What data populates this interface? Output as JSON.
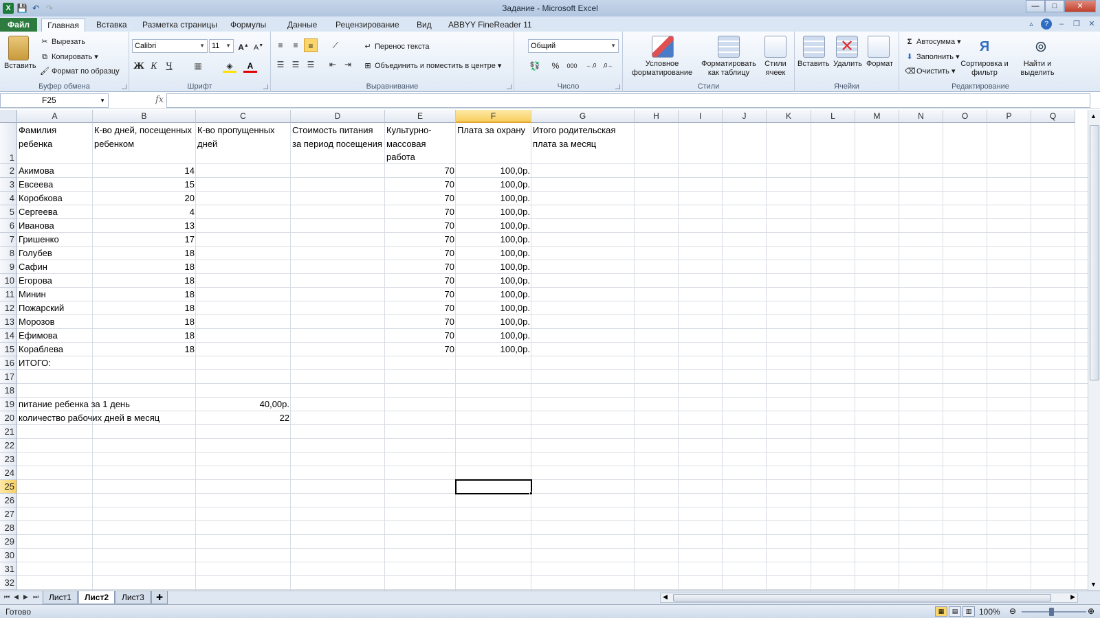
{
  "window": {
    "title": "Задание - Microsoft Excel",
    "controls": [
      "—",
      "□",
      "✕"
    ]
  },
  "qat": {
    "logo": "X",
    "save": "💾",
    "undo": "↶",
    "redo": "↷"
  },
  "tabs": {
    "file": "Файл",
    "items": [
      "Главная",
      "Вставка",
      "Разметка страницы",
      "Формулы",
      "Данные",
      "Рецензирование",
      "Вид",
      "ABBYY FineReader 11"
    ]
  },
  "ribbon": {
    "clipboard": {
      "label": "Буфер обмена",
      "paste": "Вставить",
      "cut": "Вырезать",
      "copy": "Копировать",
      "format_painter": "Формат по образцу"
    },
    "font": {
      "label": "Шрифт",
      "name": "Calibri",
      "size": "11",
      "bold": "Ж",
      "italic": "К",
      "underline": "Ч"
    },
    "alignment": {
      "label": "Выравнивание",
      "wrap": "Перенос текста",
      "merge": "Объединить и поместить в центре"
    },
    "number": {
      "label": "Число",
      "format": "Общий",
      "percent": "%",
      "thousands": "000"
    },
    "styles": {
      "label": "Стили",
      "conditional": "Условное форматирование",
      "as_table": "Форматировать как таблицу",
      "cell_styles": "Стили ячеек"
    },
    "cells": {
      "label": "Ячейки",
      "insert": "Вставить",
      "delete": "Удалить",
      "format": "Формат"
    },
    "editing": {
      "label": "Редактирование",
      "autosum": "Автосумма",
      "fill": "Заполнить",
      "clear": "Очистить",
      "sort": "Сортировка и фильтр",
      "find": "Найти и выделить"
    }
  },
  "formula_bar": {
    "name_box": "F25",
    "fx": "fx",
    "value": ""
  },
  "columns": [
    "A",
    "B",
    "C",
    "D",
    "E",
    "F",
    "G",
    "H",
    "I",
    "J",
    "K",
    "L",
    "M",
    "N",
    "O",
    "P",
    "Q"
  ],
  "rows": [
    "1",
    "2",
    "3",
    "4",
    "5",
    "6",
    "7",
    "8",
    "9",
    "10",
    "11",
    "12",
    "13",
    "14",
    "15",
    "16",
    "17",
    "18",
    "19",
    "20",
    "21",
    "22",
    "23",
    "24",
    "25",
    "26",
    "27",
    "28",
    "29",
    "30",
    "31",
    "32"
  ],
  "headers": {
    "a": "Фамилия ребенка",
    "b": "К-во дней, посещенных ребенком",
    "c": "К-во пропущенных дней",
    "d": "Стоимость питания за период посещения",
    "e": "Культурно-массовая работа",
    "f": "Плата за охрану",
    "g": "Итого родительская плата за месяц"
  },
  "data_rows": [
    {
      "name": "Акимова",
      "days": "14",
      "culture": "70",
      "guard": "100,0р."
    },
    {
      "name": "Евсеева",
      "days": "15",
      "culture": "70",
      "guard": "100,0р."
    },
    {
      "name": "Коробкова",
      "days": "20",
      "culture": "70",
      "guard": "100,0р."
    },
    {
      "name": "Сергеева",
      "days": "4",
      "culture": "70",
      "guard": "100,0р."
    },
    {
      "name": "Иванова",
      "days": "13",
      "culture": "70",
      "guard": "100,0р."
    },
    {
      "name": "Гришенко",
      "days": "17",
      "culture": "70",
      "guard": "100,0р."
    },
    {
      "name": "Голубев",
      "days": "18",
      "culture": "70",
      "guard": "100,0р."
    },
    {
      "name": "Сафин",
      "days": "18",
      "culture": "70",
      "guard": "100,0р."
    },
    {
      "name": "Егорова",
      "days": "18",
      "culture": "70",
      "guard": "100,0р."
    },
    {
      "name": "Минин",
      "days": "18",
      "culture": "70",
      "guard": "100,0р."
    },
    {
      "name": "Пожарский",
      "days": "18",
      "culture": "70",
      "guard": "100,0р."
    },
    {
      "name": "Морозов",
      "days": "18",
      "culture": "70",
      "guard": "100,0р."
    },
    {
      "name": "Ефимова",
      "days": "18",
      "culture": "70",
      "guard": "100,0р."
    },
    {
      "name": "Кораблева",
      "days": "18",
      "culture": "70",
      "guard": "100,0р."
    }
  ],
  "total_label": "ИТОГО:",
  "params": {
    "food_label": "питание ребенка за 1 день",
    "food_value": "40,00р.",
    "workdays_label": "количество рабочих дней в месяц",
    "workdays_value": "22"
  },
  "sheets": [
    "Лист1",
    "Лист2",
    "Лист3"
  ],
  "active_sheet": "Лист2",
  "status": {
    "ready": "Готово",
    "zoom": "100%"
  }
}
